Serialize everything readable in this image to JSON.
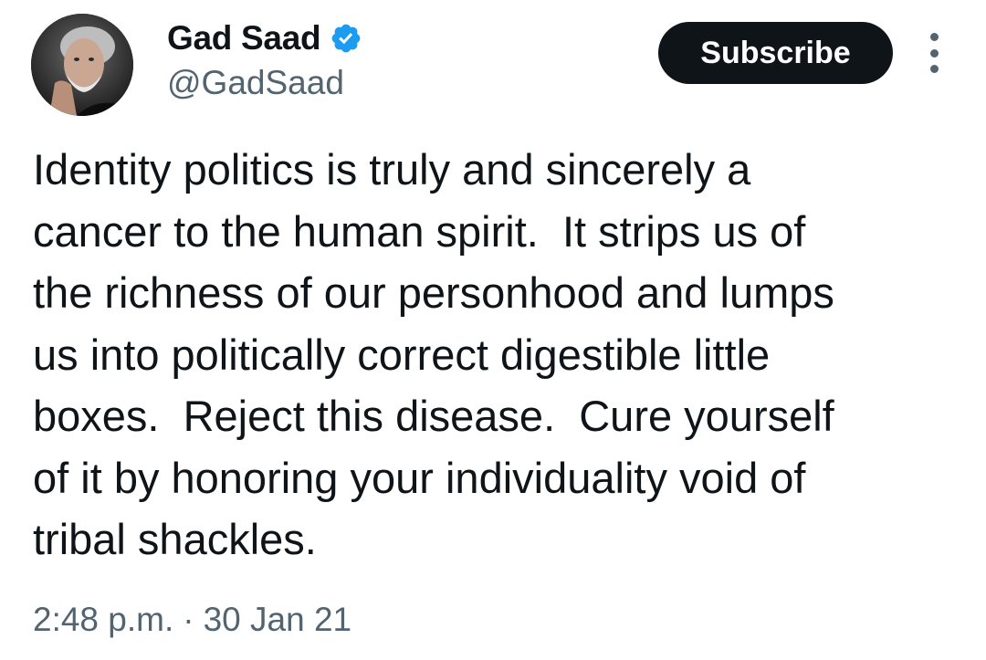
{
  "author": {
    "display_name": "Gad Saad",
    "handle": "@GadSaad",
    "verified": true,
    "verified_color": "#1d9bf0"
  },
  "actions": {
    "subscribe_label": "Subscribe",
    "more_icon": "more-vertical-icon"
  },
  "tweet": {
    "text_lines": [
      "Identity politics is truly and sincerely a",
      "cancer to the human spirit.  It strips us of",
      "the richness of our personhood and lumps",
      "us into politically correct digestible little",
      "boxes.  Reject this disease.  Cure yourself",
      "of it by honoring your individuality void of",
      "tribal shackles."
    ],
    "time": "2:48 p.m.",
    "separator": "·",
    "date": "30 Jan 21"
  },
  "colors": {
    "text_primary": "#0f1419",
    "text_secondary": "#536471",
    "button_bg": "#0f1419",
    "button_text": "#ffffff"
  }
}
